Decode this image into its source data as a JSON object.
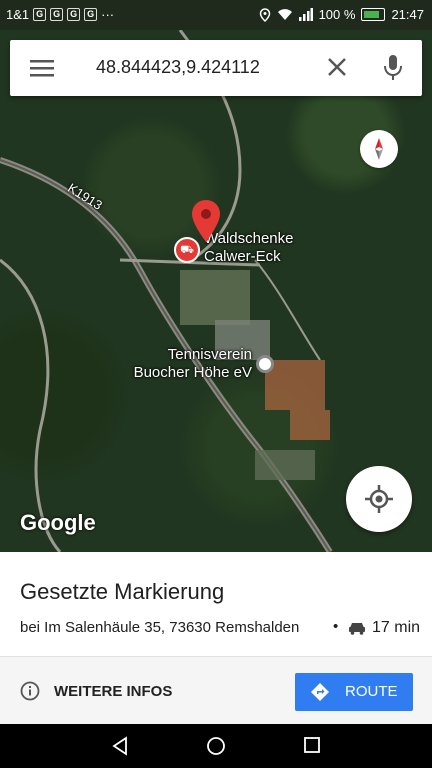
{
  "status_bar": {
    "carrier": "1&1",
    "icons": [
      "g-icon",
      "g-icon",
      "g-icon",
      "g-icon"
    ],
    "more": "···",
    "battery_percent": "100 %",
    "time": "21:47"
  },
  "search": {
    "query": "48.844423,9.424112"
  },
  "map": {
    "road_label": "K1913",
    "poi_1": {
      "line1": "Waldschenke",
      "line2": "Calwer-Eck"
    },
    "poi_2": {
      "line1": "Tennisverein",
      "line2": "Buocher Höhe eV"
    },
    "logo": "Google"
  },
  "place": {
    "title": "Gesetzte Markierung",
    "address": "bei Im Salenhäule 35, 73630 Remshalden",
    "separator": "•",
    "travel_time": "17 min"
  },
  "actions": {
    "info_label": "WEITERE INFOS",
    "route_label": "ROUTE"
  },
  "colors": {
    "accent": "#2f7df0",
    "pin": "#e53935",
    "map_bg": "#213620"
  }
}
